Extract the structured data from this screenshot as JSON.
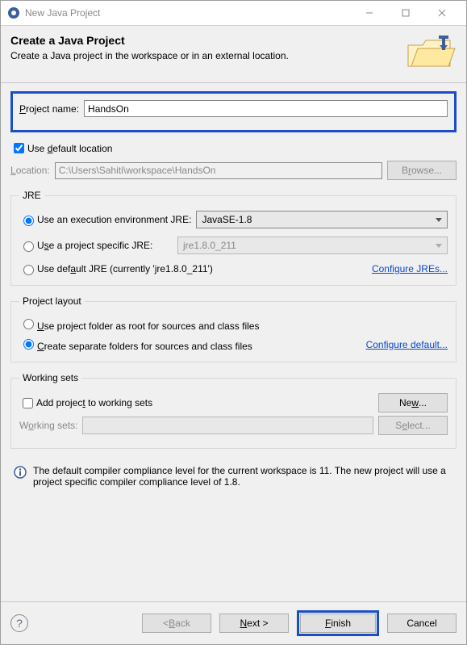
{
  "window": {
    "title": "New Java Project"
  },
  "banner": {
    "title": "Create a Java Project",
    "subtitle": "Create a Java project in the workspace or in an external location."
  },
  "fields": {
    "project_name_label": "roject name:",
    "project_name_value": "HandsOn",
    "use_default_loc": "efault location",
    "location_label": "ocation:",
    "location_value": "C:\\Users\\Sahiti\\workspace\\HandsOn",
    "browse": "owse..."
  },
  "jre": {
    "legend": "JRE",
    "exec_env": "Use an execution environment JRE:",
    "exec_env_value": "JavaSE-1.8",
    "project_specific": "e a project specific JRE:",
    "project_specific_value": "jre1.8.0_211",
    "default_jre": "ult JRE (currently 'jre1.8.0_211')"
  },
  "layout": {
    "legend": "Project layout",
    "root_folder": "se project folder as root for sources and class files",
    "separate": "reate separate folders for sources and class files"
  },
  "ws": {
    "legend": "Working sets",
    "add": " to working sets",
    "label": "rking sets:",
    "select": "lect..."
  },
  "info": {
    "text": "The default compiler compliance level for the current workspace is 11. The new project will use a project specific compiler compliance level of 1.8."
  },
  "footer": {
    "back": "ack",
    "next": "ext >",
    "finish": "inish",
    "cancel": "Cancel"
  }
}
